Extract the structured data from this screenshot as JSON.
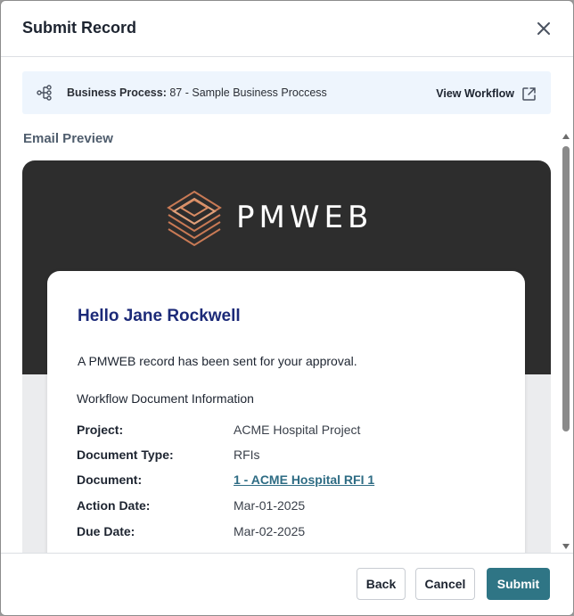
{
  "dialog": {
    "title": "Submit Record"
  },
  "business_process": {
    "label": "Business Process:",
    "value": "87 - Sample Business Proccess",
    "view_workflow": "View Workflow"
  },
  "email_preview": {
    "section_label": "Email Preview",
    "logo_text": "PMWEB",
    "greeting": "Hello Jane Rockwell",
    "message": "A PMWEB record has been sent for your approval.",
    "info_title": "Workflow Document  Information",
    "fields": [
      {
        "label": "Project:",
        "value": "ACME Hospital Project"
      },
      {
        "label": "Document Type:",
        "value": "RFIs"
      },
      {
        "label": "Document:",
        "value": "1 - ACME Hospital RFI 1"
      },
      {
        "label": "Action Date:",
        "value": "Mar-01-2025"
      },
      {
        "label": "Due Date:",
        "value": "Mar-02-2025"
      }
    ]
  },
  "footer": {
    "back_label": "Back",
    "cancel_label": "Cancel",
    "submit_label": "Submit"
  },
  "colors": {
    "accent": "#2f7585",
    "greeting": "#1c2a78",
    "link": "#2e6c84",
    "email_header": "#2d2d2d",
    "logo_copper": "#c97a55"
  },
  "icons": {
    "close": "close-icon",
    "workflow": "workflow-icon",
    "external": "external-link-icon"
  }
}
